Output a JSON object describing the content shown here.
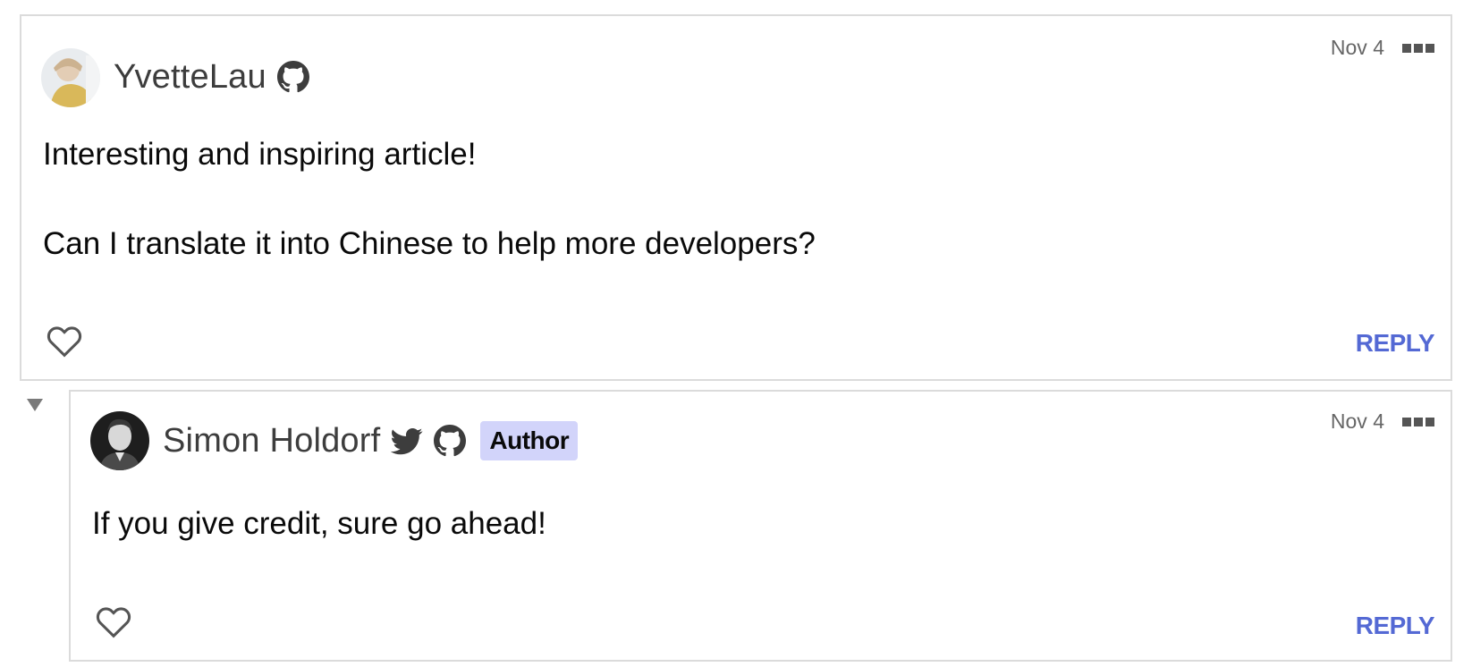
{
  "comments": [
    {
      "author": "YvetteLau",
      "social_icons": [
        "github-icon"
      ],
      "date": "Nov 4",
      "body": [
        "Interesting and inspiring article!",
        "Can I translate it into Chinese to help more developers?"
      ],
      "reply_label": "REPLY"
    },
    {
      "author": "Simon Holdorf",
      "social_icons": [
        "twitter-icon",
        "github-icon"
      ],
      "badge": "Author",
      "date": "Nov 4",
      "body": [
        "If you give credit, sure go ahead!"
      ],
      "reply_label": "REPLY"
    }
  ],
  "colors": {
    "reply_link": "#5469d4",
    "author_badge_bg": "#d2d4fa",
    "border": "#dbdbdb",
    "muted_text": "#666666"
  },
  "icons": {
    "like": "heart-outline-icon",
    "more": "more-options-icon",
    "collapse": "collapse-triangle-icon"
  }
}
